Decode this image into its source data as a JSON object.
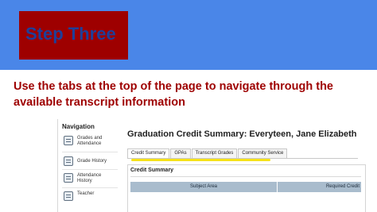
{
  "slide": {
    "title": "Step Three",
    "instruction": "Use the tabs at the top of the page to navigate through the available transcript information",
    "colors": {
      "band": "#4a86e8",
      "box": "#9e0000",
      "title": "#1e3f9a",
      "instruction": "#9e0000",
      "highlight": "#f6e21a"
    }
  },
  "navigation": {
    "heading": "Navigation",
    "items": [
      {
        "label": "Grades and Attendance",
        "icon": "grades-icon"
      },
      {
        "label": "Grade History",
        "icon": "history-icon"
      },
      {
        "label": "Attendance History",
        "icon": "attendance-icon"
      },
      {
        "label": "Teacher",
        "icon": "teacher-icon"
      }
    ]
  },
  "page": {
    "title": "Graduation Credit Summary: Everyteen, Jane Elizabeth",
    "tabs": [
      "Credit Summary",
      "GPAs",
      "Transcript Grades",
      "Community Service"
    ],
    "active_tab": "Credit Summary",
    "section_title": "Credit Summary",
    "columns": [
      "Subject Area",
      "Required Credit"
    ]
  }
}
